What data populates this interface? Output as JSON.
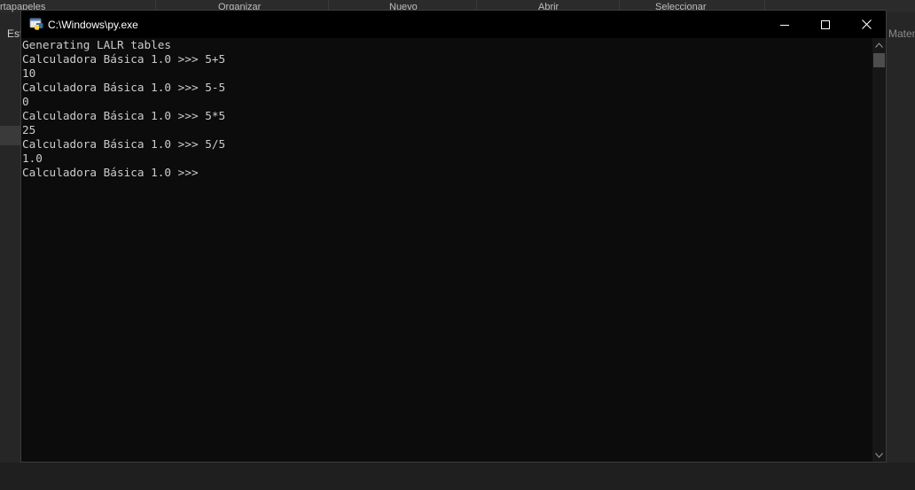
{
  "background": {
    "ribbon_groups": [
      "rtapapeles",
      "Organizar",
      "Nuevo",
      "Abrir",
      "Seleccionar"
    ],
    "left_tab": "Est",
    "right_tab": "Matem"
  },
  "window": {
    "title": "C:\\Windows\\py.exe",
    "icons": {
      "app": "python-launcher-icon",
      "minimize": "minimize-icon",
      "maximize": "maximize-icon",
      "close": "close-icon"
    },
    "console_lines": [
      "Generating LALR tables",
      "Calculadora Básica 1.0 >>> 5+5",
      "10",
      "Calculadora Básica 1.0 >>> 5-5",
      "0",
      "Calculadora Básica 1.0 >>> 5*5",
      "25",
      "Calculadora Básica 1.0 >>> 5/5",
      "1.0",
      "Calculadora Básica 1.0 >>> "
    ]
  },
  "colors": {
    "console_bg": "#0c0c0c",
    "console_text": "#cccccc",
    "titlebar_bg": "#000000"
  }
}
